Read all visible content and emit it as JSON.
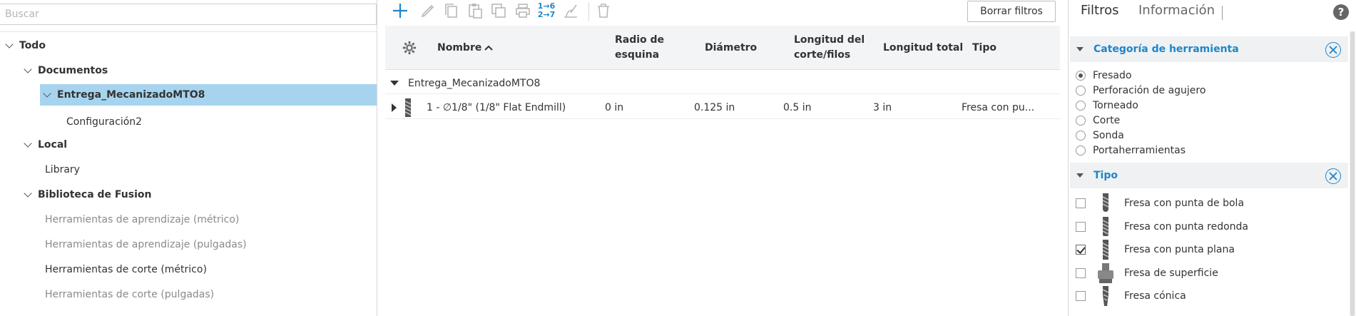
{
  "left_panel": {
    "search_placeholder": "Buscar",
    "tree": {
      "todo": "Todo",
      "documentos": "Documentos",
      "selected_doc": "Entrega_MecanizadoMTO8",
      "config": "Configuración2",
      "local": "Local",
      "library": "Library",
      "fusion": "Biblioteca de Fusion",
      "fusion_items": [
        "Herramientas de aprendizaje (métrico)",
        "Herramientas de aprendizaje (pulgadas)",
        "Herramientas de corte (métrico)",
        "Herramientas de corte (pulgadas)"
      ]
    }
  },
  "toolbar": {
    "clear_filters_label": "Borrar filtros",
    "renumber_top": "1→6",
    "renumber_bottom": "2→7",
    "icons": [
      "add-icon",
      "edit-icon",
      "copy-icon",
      "paste-icon",
      "duplicate-icon",
      "print-icon",
      "renumber-icon",
      "feeds-speeds-icon",
      "delete-icon"
    ],
    "accent_color": "#1d86c9",
    "disabled_color": "#b8b8b8"
  },
  "table": {
    "columns": {
      "name": "Nombre",
      "corner_radius_line1": "Radio de",
      "corner_radius_line2": "esquina",
      "diameter": "Diámetro",
      "flute_length_line1": "Longitud del",
      "flute_length_line2": "corte/filos",
      "overall_length": "Longitud total",
      "type": "Tipo"
    },
    "group": "Entrega_MecanizadoMTO8",
    "rows": [
      {
        "name": "1 - ∅1/8\" (1/8\" Flat Endmill)",
        "corner_radius": "0 in",
        "diameter": "0.125 in",
        "flute_length": "0.5 in",
        "overall_length": "3 in",
        "type": "Fresa con pu..."
      }
    ]
  },
  "right_panel": {
    "tabs": {
      "filters": "Filtros",
      "info": "Información"
    },
    "help": "?",
    "category": {
      "title": "Categoría de herramienta",
      "options": [
        "Fresado",
        "Perforación de agujero",
        "Torneado",
        "Corte",
        "Sonda",
        "Portaherramientas"
      ],
      "selected": "Fresado"
    },
    "type": {
      "title": "Tipo",
      "options": [
        {
          "label": "Fresa con punta de bola",
          "checked": false,
          "icon": "ball-endmill-icon"
        },
        {
          "label": "Fresa con punta redonda",
          "checked": false,
          "icon": "bull-nose-endmill-icon"
        },
        {
          "label": "Fresa con punta plana",
          "checked": true,
          "icon": "flat-endmill-icon"
        },
        {
          "label": "Fresa de superficie",
          "checked": false,
          "icon": "face-mill-icon"
        },
        {
          "label": "Fresa cónica",
          "checked": false,
          "icon": "tapered-mill-icon"
        }
      ]
    },
    "selection_color": "#a6d4ef"
  }
}
